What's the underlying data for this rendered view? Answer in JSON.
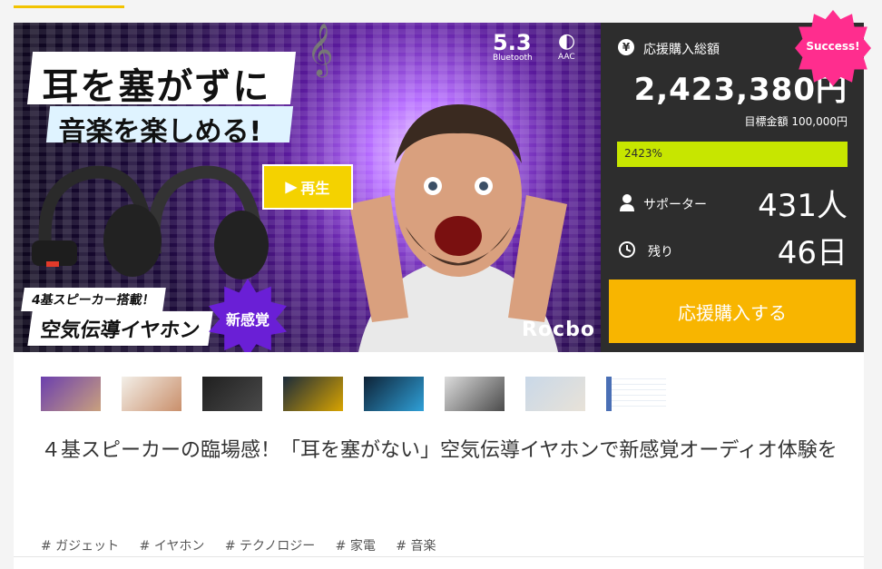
{
  "hero": {
    "headline_line1": "耳を塞がずに",
    "headline_line2": "音楽を楽しめる!",
    "bluetooth_version": "5.3",
    "bluetooth_label": "Bluetooth",
    "codec_label": "AAC",
    "speaker_badge": "4基スピーカー搭載！",
    "product_name": "空気伝導イヤホン",
    "new_badge": "新感覚",
    "play_button": "再生",
    "brand_logo": "Rocbo"
  },
  "sidebar": {
    "total_label": "応援購入総額",
    "total_amount": "2,423,380円",
    "target_text": "目標金額 100,000円",
    "progress_percent": 2423,
    "progress_text": "2423%",
    "supporters_label": "サポーター",
    "supporters_count": "431人",
    "remaining_label": "残り",
    "remaining_days": "46日",
    "support_button": "応援購入する",
    "success_badge": "Success!"
  },
  "thumbnails": [
    {
      "name": "thumb-1"
    },
    {
      "name": "thumb-2"
    },
    {
      "name": "thumb-3"
    },
    {
      "name": "thumb-4"
    },
    {
      "name": "thumb-5"
    },
    {
      "name": "thumb-6"
    },
    {
      "name": "thumb-7"
    },
    {
      "name": "thumb-8"
    }
  ],
  "project_title": "４基スピーカーの臨場感！「耳を塞がない」空気伝導イヤホンで新感覚オーディオ体験を",
  "tags": [
    "# ガジェット",
    "# イヤホン",
    "# テクノロジー",
    "# 家電",
    "# 音楽"
  ],
  "colors": {
    "accent": "#f2c300",
    "support_button": "#f8b500",
    "progress_bar": "#c7e600",
    "sidebar_bg": "#2d2d2d",
    "success_badge": "#ff2d8e"
  }
}
